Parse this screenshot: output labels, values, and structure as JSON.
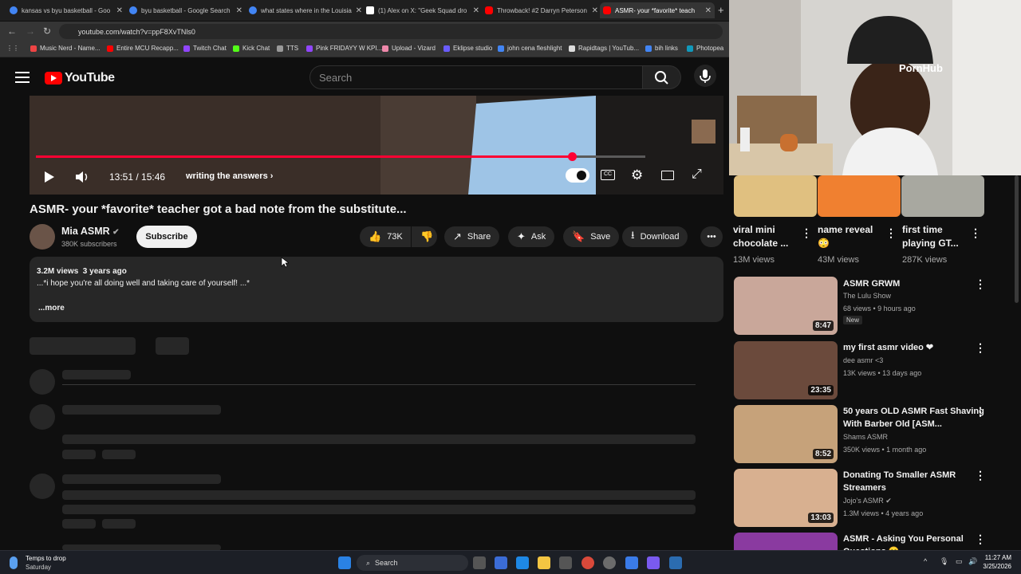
{
  "browser": {
    "tabs": [
      {
        "title": "kansas vs byu basketball - Goo",
        "color": "#4285f4"
      },
      {
        "title": "byu basketball - Google Search",
        "color": "#4285f4"
      },
      {
        "title": "what states where in the Louisia",
        "color": "#4285f4"
      },
      {
        "title": "(1) Alex on X: \"Geek Squad dro",
        "color": "#ffffff"
      },
      {
        "title": "Throwback! #2 Darryn Peterson",
        "color": "#ff0000"
      },
      {
        "title": "ASMR- your *favorite* teach",
        "color": "#ff0000",
        "active": true
      }
    ],
    "url": "youtube.com/watch?v=ppF8XvTNls0",
    "bookmarks": [
      {
        "label": "Music Nerd - Name...",
        "color": "#e44"
      },
      {
        "label": "Entire MCU Recapp...",
        "color": "#f00"
      },
      {
        "label": "Twitch Chat",
        "color": "#9146ff"
      },
      {
        "label": "Kick Chat",
        "color": "#53fc18"
      },
      {
        "label": "TTS",
        "color": "#999"
      },
      {
        "label": "Pink FRIDAYY W KPI...",
        "color": "#9146ff"
      },
      {
        "label": "Upload - Vizard",
        "color": "#e8a"
      },
      {
        "label": "Eklipse studio",
        "color": "#6a5cff"
      },
      {
        "label": "john cena fleshlight",
        "color": "#4285f4"
      },
      {
        "label": "Rapidtags | YouTub...",
        "color": "#ddd"
      },
      {
        "label": "bih links",
        "color": "#4285f4"
      },
      {
        "label": "Photopea",
        "color": "#19b"
      }
    ]
  },
  "youtube": {
    "logo_text": "YouTube",
    "search_placeholder": "Search"
  },
  "player": {
    "time": "13:51 / 15:46",
    "chapter": "writing the answers",
    "progress_fraction": 0.88
  },
  "video": {
    "title": "ASMR- your *favorite* teacher got a bad note from the substitute...",
    "channel": "Mia ASMR",
    "subscribers": "380K subscribers",
    "subscribe_label": "Subscribe",
    "likes": "73K",
    "share_label": "Share",
    "ask_label": "Ask",
    "save_label": "Save",
    "download_label": "Download",
    "views_date": "3.2M views  3 years ago",
    "description": "...*i hope you're all doing well and taking care of yourself! ...*",
    "more_label": "...more"
  },
  "webcam": {
    "hat_text": "PornHub"
  },
  "shorts": [
    {
      "title": "viral mini chocolate ...",
      "views": "13M views",
      "color": "#e0c080"
    },
    {
      "title": "name reveal 😳",
      "views": "43M views",
      "color": "#f08030"
    },
    {
      "title": "first time playing GT...",
      "views": "287K views",
      "color": "#a8a8a0"
    }
  ],
  "related": [
    {
      "title": "ASMR GRWM",
      "channel": "The Lulu Show",
      "meta": "68 views • 9 hours ago",
      "badge": "New",
      "duration": "8:47",
      "color": "#c9a79a"
    },
    {
      "title": "my first asmr video ❤",
      "channel": "dee asmr <3",
      "meta": "13K views • 13 days ago",
      "badge": "",
      "duration": "23:35",
      "color": "#6b4a3c"
    },
    {
      "title": "50 years OLD ASMR Fast Shaving With Barber Old [ASM...",
      "channel": "Shams ASMR",
      "meta": "350K views • 1 month ago",
      "badge": "",
      "duration": "8:52",
      "color": "#c6a27a"
    },
    {
      "title": "Donating To Smaller ASMR Streamers",
      "channel": "Jojo's ASMR ✔",
      "meta": "1.3M views • 4 years ago",
      "badge": "",
      "duration": "13:03",
      "color": "#d8b090"
    },
    {
      "title": "ASMR - Asking You Personal Questions 😊",
      "channel": "",
      "meta": "",
      "badge": "",
      "duration": "",
      "color": "#8a3aa0"
    }
  ],
  "taskbar": {
    "weather_title": "Temps to drop",
    "weather_sub": "Saturday",
    "search_label": "Search",
    "time": "11:27 AM",
    "date": "3/25/2026"
  }
}
